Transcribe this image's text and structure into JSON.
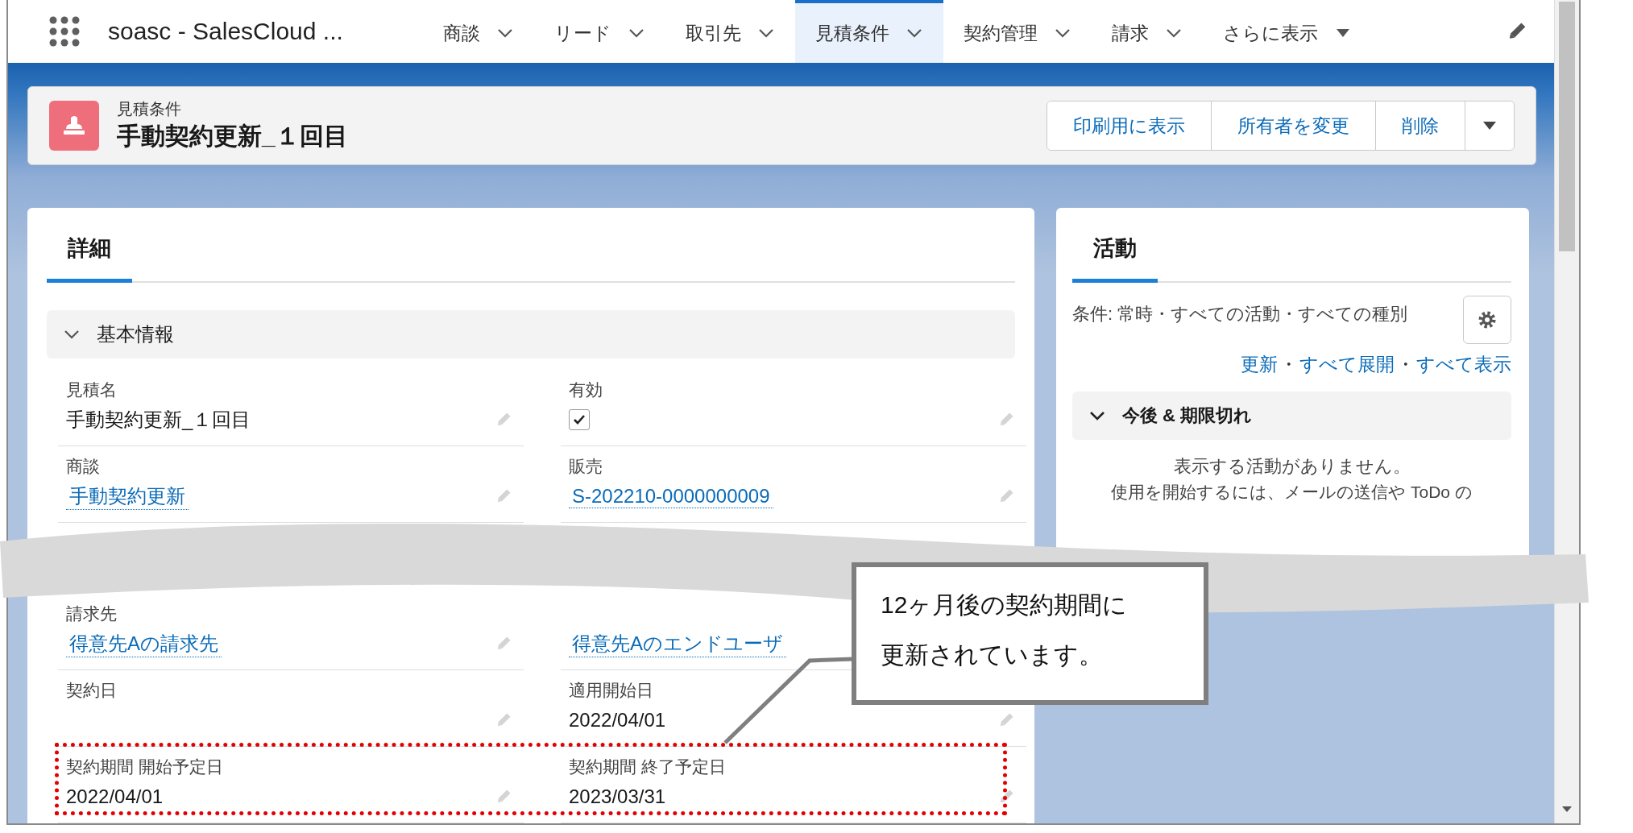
{
  "app": {
    "name": "soasc - SalesCloud ..."
  },
  "nav_tabs": [
    {
      "label": "商談",
      "selected": false,
      "kind": "dropdown"
    },
    {
      "label": "リード",
      "selected": false,
      "kind": "dropdown"
    },
    {
      "label": "取引先",
      "selected": false,
      "kind": "dropdown"
    },
    {
      "label": "見積条件",
      "selected": true,
      "kind": "dropdown"
    },
    {
      "label": "契約管理",
      "selected": false,
      "kind": "dropdown"
    },
    {
      "label": "請求",
      "selected": false,
      "kind": "dropdown"
    },
    {
      "label": "さらに表示",
      "selected": false,
      "kind": "more"
    }
  ],
  "record": {
    "type": "見積条件",
    "title": "手動契約更新_１回目"
  },
  "actions": [
    "印刷用に表示",
    "所有者を変更",
    "削除"
  ],
  "detail": {
    "tab": {
      "label": "詳細",
      "selected": true
    },
    "section": {
      "title": "基本情報",
      "expanded": true
    },
    "fields_top": [
      {
        "kind": "text",
        "label": "見積名",
        "value": "手動契約更新_１回目"
      },
      {
        "kind": "checkbox",
        "label": "有効",
        "checked": true
      },
      {
        "kind": "link",
        "label": "商談",
        "value": "手動契約更新"
      },
      {
        "kind": "link",
        "label": "販売",
        "value": "S-202210-0000000009"
      }
    ],
    "fields_bottom": [
      {
        "kind": "link",
        "label": "請求先",
        "value": "得意先Aの請求先"
      },
      {
        "kind": "link",
        "value": "得意先Aのエンドユーザ"
      },
      {
        "kind": "text",
        "label": "契約日"
      },
      {
        "kind": "text",
        "label": "適用開始日",
        "value": "2022/04/01"
      },
      {
        "kind": "text",
        "label": "契約期間 開始予定日",
        "value": "2022/04/01"
      },
      {
        "kind": "text",
        "label": "契約期間 終了予定日",
        "value": "2023/03/31"
      }
    ]
  },
  "activity": {
    "tab": {
      "label": "活動",
      "selected": true
    },
    "filter": "条件: 常時・すべての活動・すべての種別",
    "links": [
      {
        "kind": "link",
        "label": "更新"
      },
      {
        "kind": "separator",
        "label": "・"
      },
      {
        "kind": "link",
        "label": "すべて展開"
      },
      {
        "kind": "separator",
        "label": "・"
      },
      {
        "kind": "link",
        "label": "すべて表示"
      }
    ],
    "section": {
      "title": "今後 & 期限切れ",
      "expanded": true
    },
    "empty_message": "表示する活動がありません。",
    "hint": "使用を開始するには、メールの送信や ToDo の"
  },
  "annotation": {
    "callout": "12ヶ月後の契約期間に更新されています。"
  }
}
